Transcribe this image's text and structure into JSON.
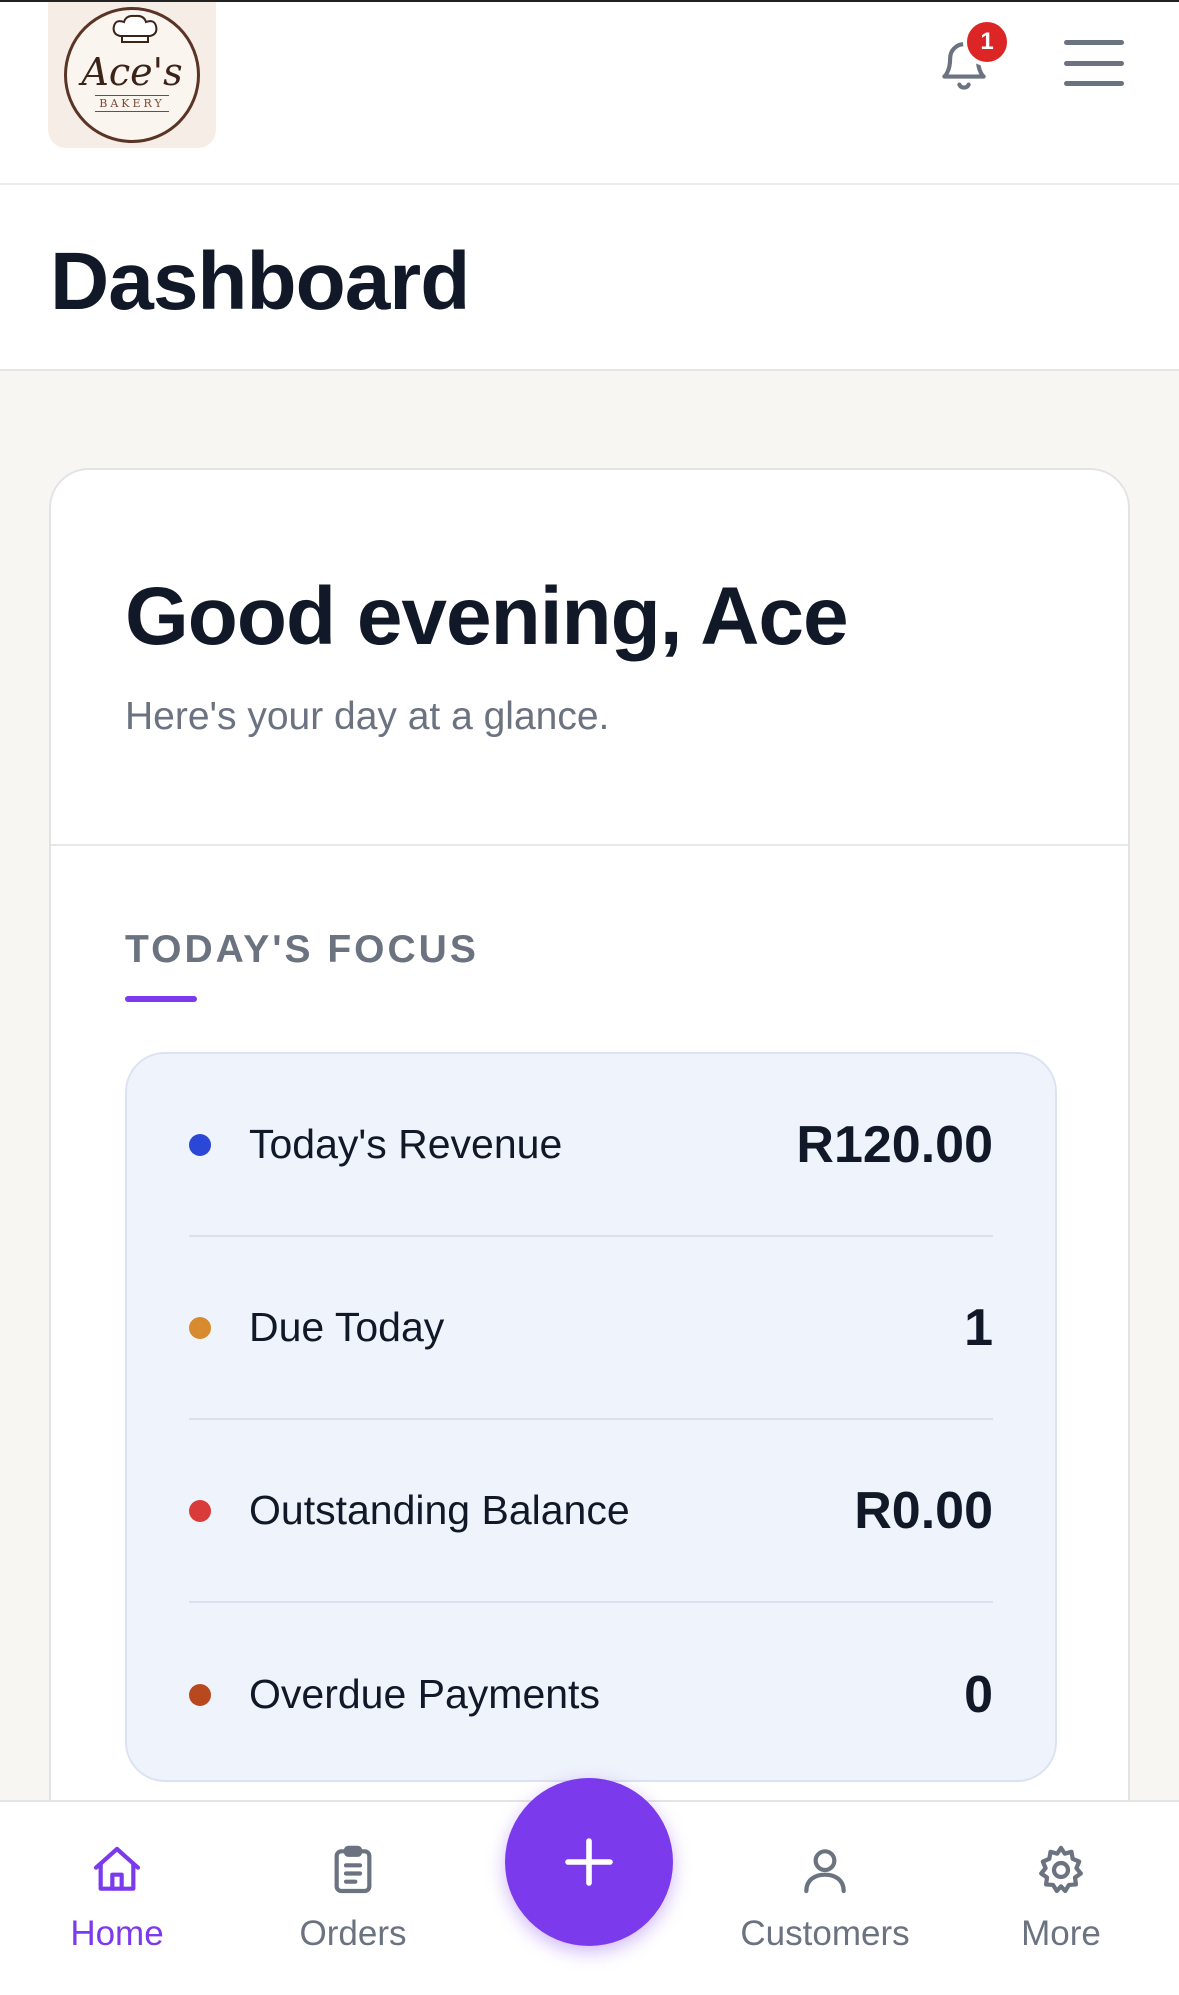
{
  "header": {
    "logo": {
      "name": "Ace's",
      "sub": "BAKERY"
    },
    "notification_count": "1"
  },
  "title": "Dashboard",
  "greeting": {
    "title": "Good evening, Ace",
    "subtitle": "Here's your day at a glance."
  },
  "focus": {
    "label": "TODAY'S FOCUS",
    "items": [
      {
        "label": "Today's Revenue",
        "value": "R120.00",
        "dot_color": "#2b47d6"
      },
      {
        "label": "Due Today",
        "value": "1",
        "dot_color": "#d88a2e"
      },
      {
        "label": "Outstanding Balance",
        "value": "R0.00",
        "dot_color": "#d93a3a"
      },
      {
        "label": "Overdue Payments",
        "value": "0",
        "dot_color": "#b8491f"
      }
    ]
  },
  "nav": {
    "items": [
      {
        "label": "Home",
        "icon": "home-icon",
        "active": true
      },
      {
        "label": "Orders",
        "icon": "clipboard-icon",
        "active": false
      },
      {
        "label": "Customers",
        "icon": "user-icon",
        "active": false
      },
      {
        "label": "More",
        "icon": "gear-icon",
        "active": false
      }
    ],
    "fab_icon": "plus-icon"
  },
  "colors": {
    "accent": "#7c3aed",
    "badge": "#dc2626",
    "focus_panel": "#eff3fb"
  }
}
